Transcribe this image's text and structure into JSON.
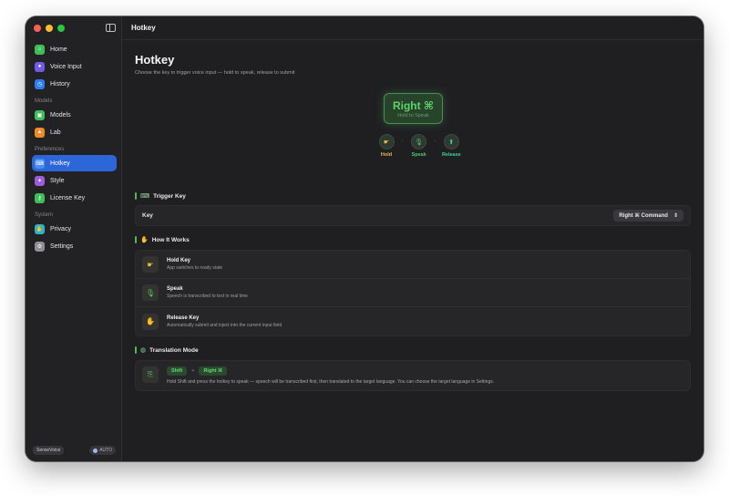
{
  "sidebar": {
    "items_main": [
      {
        "label": "Home",
        "icon": "house-icon",
        "color": "#3fbf5a",
        "glyph": "⌂"
      },
      {
        "label": "Voice Input",
        "icon": "microphone-icon",
        "color": "#6d5ce8",
        "glyph": "●"
      },
      {
        "label": "History",
        "icon": "clock-icon",
        "color": "#2c7cf0",
        "glyph": "◷"
      }
    ],
    "sections": [
      {
        "title": "Models",
        "items": [
          {
            "label": "Models",
            "icon": "cpu-icon",
            "color": "#3fbf5a",
            "glyph": "▣"
          },
          {
            "label": "Lab",
            "icon": "flask-icon",
            "color": "#f08a24",
            "glyph": "▲"
          }
        ]
      },
      {
        "title": "Preferences",
        "items": [
          {
            "label": "Hotkey",
            "icon": "keyboard-icon",
            "color": "#4a8cf0",
            "glyph": "⌨",
            "active": true
          },
          {
            "label": "Style",
            "icon": "sparkle-icon",
            "color": "#9b5ce0",
            "glyph": "✦"
          },
          {
            "label": "License Key",
            "icon": "key-icon",
            "color": "#3fbf5a",
            "glyph": "⚷"
          }
        ]
      },
      {
        "title": "System",
        "items": [
          {
            "label": "Privacy",
            "icon": "hand-icon",
            "color": "#2fb3c9",
            "glyph": "✋"
          },
          {
            "label": "Settings",
            "icon": "gear-icon",
            "color": "#8e8e94",
            "glyph": "⚙"
          }
        ]
      }
    ],
    "footer": {
      "model": "SenseVoice",
      "mode": "AUTO"
    }
  },
  "topbar": {
    "title": "Hotkey"
  },
  "page": {
    "title": "Hotkey",
    "subtitle": "Choose the key to trigger voice input — hold to speak, release to submit"
  },
  "hero": {
    "key": "Right ⌘",
    "caption": "Hold to Speak",
    "steps": [
      {
        "label": "Hold",
        "icon": "hand-point-icon",
        "color": "#e6b84a",
        "glyph": "☛"
      },
      {
        "label": "Speak",
        "icon": "microphone-icon",
        "color": "#4fc46a",
        "glyph": "🎙"
      },
      {
        "label": "Release",
        "icon": "release-icon",
        "color": "#3fcfa0",
        "glyph": "⬆"
      }
    ]
  },
  "trigger": {
    "section_title": "Trigger Key",
    "row_label": "Key",
    "selected": "Right ⌘ Command"
  },
  "how": {
    "section_title": "How It Works",
    "rows": [
      {
        "title": "Hold Key",
        "desc": "App switches to ready state",
        "icon": "hand-point-icon",
        "glyph": "☛",
        "color": "#e6b84a"
      },
      {
        "title": "Speak",
        "desc": "Speech is transcribed to text in real time",
        "icon": "microphone-icon",
        "glyph": "🎙",
        "color": "#4fc46a"
      },
      {
        "title": "Release Key",
        "desc": "Automatically submit and inject into the current input field",
        "icon": "hand-icon",
        "glyph": "✋",
        "color": "#3fcfa0"
      }
    ]
  },
  "translation": {
    "section_title": "Translation Mode",
    "key1": "Shift",
    "plus": "+",
    "key2": "Right ⌘",
    "desc": "Hold Shift and press the hotkey to speak — speech will be transcribed first, then translated to the target language. You can choose the target language in Settings."
  }
}
